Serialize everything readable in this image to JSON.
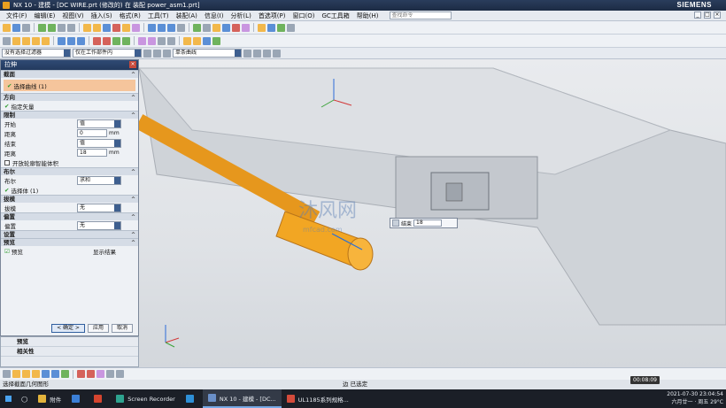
{
  "window": {
    "title": "NX 10 - 建模 - [DC WIRE.prt  (修改的)   在 装配 power_asm1.prt]",
    "brand": "SIEMENS",
    "controls": [
      "_",
      "□",
      "×"
    ]
  },
  "menubar": {
    "items": [
      "文件(F)",
      "编辑(E)",
      "视图(V)",
      "插入(S)",
      "格式(R)",
      "工具(T)",
      "装配(A)",
      "信息(I)",
      "分析(L)",
      "首选项(P)",
      "窗口(O)",
      "GC工具箱",
      "帮助(H)"
    ],
    "search_placeholder": "查找命令"
  },
  "filterbar": {
    "selection_filter": "没有选择过滤器",
    "scope": "仅在工作部件内",
    "curve_rule": "单条曲线"
  },
  "dialog": {
    "title": "拉伸",
    "sections": {
      "section": "截面",
      "direction": "方向",
      "limits": "限制",
      "boolean": "布尔",
      "draft": "拔模",
      "offset": "偏置",
      "settings": "设置",
      "preview": "预览"
    },
    "select_curve": "选择曲线 (1)",
    "specify_vector": "指定矢量",
    "start_label": "开始",
    "start_value": "值",
    "distance_label": "距离",
    "start_distance": "0",
    "unit": "mm",
    "end_label": "结束",
    "end_value": "值",
    "end_distance": "18",
    "open_profile": "开放轮廓智能体积",
    "boolean_label": "布尔",
    "boolean_value": "求和",
    "select_body": "选择体 (1)",
    "draft_label": "拔模",
    "draft_value": "无",
    "offset_label": "偏置",
    "offset_value": "无",
    "preview_label": "预览",
    "show_result": "显示结果",
    "ok": "< 确定 >",
    "apply": "应用",
    "cancel": "取消"
  },
  "resources": {
    "items": [
      "预览",
      "相关性"
    ]
  },
  "float_input": {
    "label": "结束",
    "value": "18"
  },
  "status": {
    "left": "选择截面几何图形",
    "right": "边 已选定"
  },
  "watermark": {
    "text": "沐风网",
    "url": "mfcad.com"
  },
  "recorder_timer": "00:08:09",
  "taskbar": {
    "items": [
      {
        "label": "附件",
        "color": "#e2b33c"
      },
      {
        "label": "",
        "color": "#3b7fd6"
      },
      {
        "label": "",
        "color": "#d5452f"
      },
      {
        "label": "Screen Recorder",
        "color": "#2ea38f"
      },
      {
        "label": "",
        "color": "#2e8fd6"
      },
      {
        "label": "NX 10 - 建模 - [DC...",
        "color": "#6a8fc7"
      },
      {
        "label": "UL1185系列规格...",
        "color": "#d44b3b"
      }
    ],
    "datetime": "2021-07-30  23:04:54",
    "weather": "六月廿一 · 周五  29°C"
  },
  "colors": {
    "accent": "#2f4a74",
    "selection_highlight": "#f5c59c",
    "cable": "#f0a022"
  }
}
